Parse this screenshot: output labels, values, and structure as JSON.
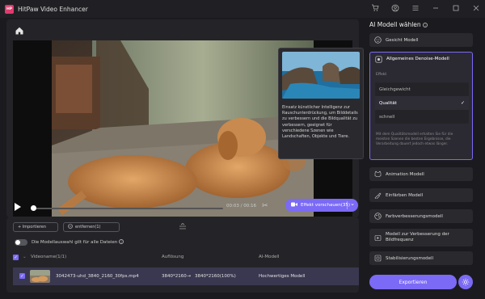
{
  "app": {
    "title": "HitPaw Video Enhancer",
    "logo_text": "HitPaw"
  },
  "player": {
    "time": "00:03 / 00:16",
    "progress": 0.0,
    "preview_label": "Effekt vorschauen(35)"
  },
  "tooltip": {
    "text": "Einsatz künstlicher Intelligenz zur Rauschunterdrückung, um Bilddetails zu verbessern und die Bildqualität zu verbessern, geeignet für verschiedene Szenen wie Landschaften, Objekte und Tiere."
  },
  "toolbar": {
    "import_label": "+ Importieren",
    "remove_label": "entfernen(1)"
  },
  "apply_all": {
    "label": "Die Modellauswahl gilt für alle Dateien"
  },
  "table": {
    "headers": {
      "name": "Videoname(1/1)",
      "resolution": "Auflösung",
      "model": "AI-Modell"
    },
    "rows": [
      {
        "name": "3042473-uhd_3840_2160_30fps.mp4",
        "res_from": "3840*2160",
        "res_to": "3840*2160(100%)",
        "model": "Hochwertiges Modell"
      }
    ]
  },
  "sidebar": {
    "title": "AI Modell wählen",
    "models": [
      {
        "label": "Gesicht Modell",
        "icon": "face-icon"
      },
      {
        "label": "Allgemeines Denoise-Modell",
        "icon": "denoise-icon"
      },
      {
        "label": "Animation Modell",
        "icon": "animation-icon"
      },
      {
        "label": "Einfärben Modell",
        "icon": "colorize-icon"
      },
      {
        "label": "Farbverbesserungsmodell",
        "icon": "color-enhance-icon"
      },
      {
        "label": "Modell zur Verbesserung der Bildfrequenz",
        "icon": "frame-rate-icon"
      },
      {
        "label": "Stabilisierungsmodell",
        "icon": "stabilize-icon"
      }
    ],
    "effect_label": "Effekt",
    "effect_options": [
      "Gleichgewicht",
      "Qualität",
      "schnell"
    ],
    "effect_selected": "Qualität",
    "description": "Mit dem Qualitätsmodell erhalten Sie für die meisten Szenen die besten Ergebnisse, die Verarbeitung dauert jedoch etwas länger.",
    "export_label": "Exportieren"
  },
  "colors": {
    "accent": "#7b6af5",
    "row_selected": "#3a3850",
    "brand": "#e03a6e"
  }
}
